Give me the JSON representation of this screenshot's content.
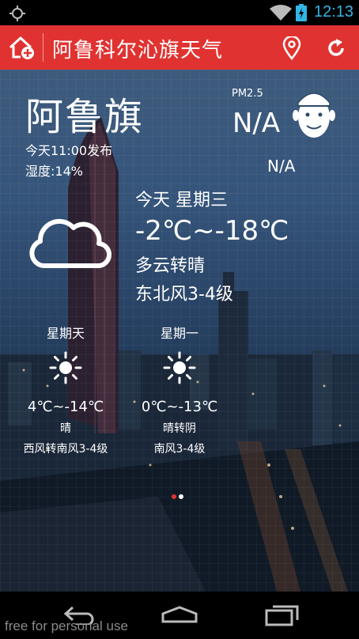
{
  "status_bar": {
    "time": "12:13"
  },
  "app_bar": {
    "title": "阿鲁科尔沁旗天气"
  },
  "current": {
    "city": "阿鲁旗",
    "publish_time": "今天11:00发布",
    "humidity": "湿度:14%",
    "pm_label": "PM2.5",
    "pm_value": "N/A",
    "pm_status": "N/A"
  },
  "today": {
    "day": "今天 星期三",
    "temp": "-2℃~-18℃",
    "condition": "多云转晴",
    "wind": "东北风3-4级",
    "icon": "cloud-icon"
  },
  "forecast": [
    {
      "day": "星期天",
      "temp": "4℃~-14℃",
      "condition": "晴",
      "wind": "西风转南风3-4级",
      "icon": "sun-icon"
    },
    {
      "day": "星期一",
      "temp": "0℃~-13℃",
      "condition": "晴转阴",
      "wind": "南风3-4级",
      "icon": "sun-icon"
    }
  ],
  "page_indicator": {
    "total": 2,
    "active": 0
  },
  "colors": {
    "accent": "#e03331",
    "status_blue": "#33b5e5",
    "dot_active": "#e03331",
    "dot_inactive": "#ffffff"
  },
  "watermark": "free for personal use"
}
